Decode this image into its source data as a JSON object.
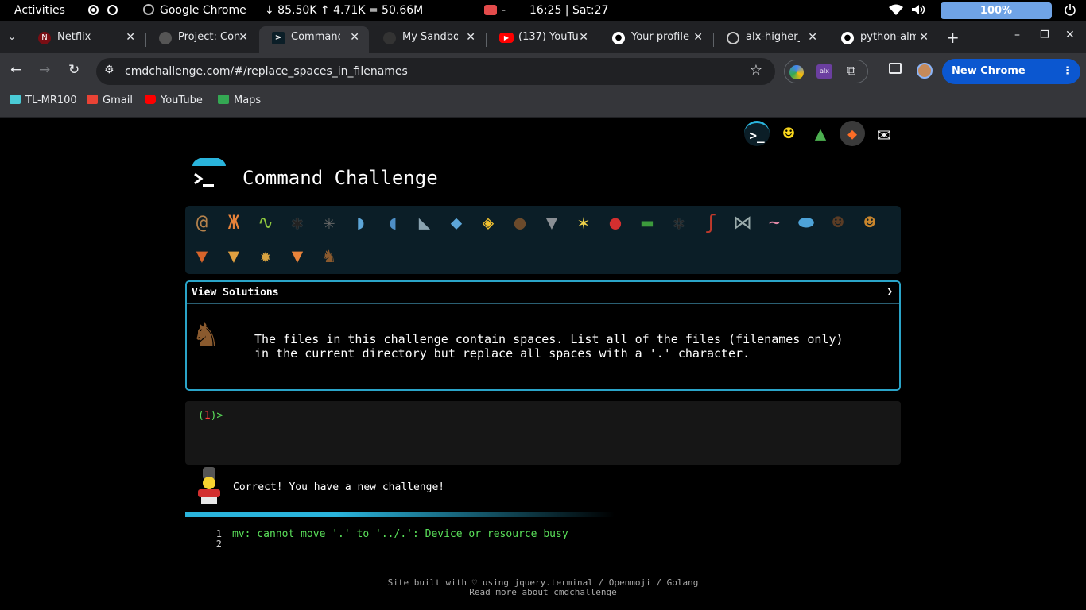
{
  "topbar": {
    "activities": "Activities",
    "app_name": "Google Chrome",
    "net_stats": "↓ 85.50K ↑ 4.71K = 50.66M",
    "indicator_dash": "-",
    "clock": "16:25 | Sat:27",
    "battery": "100%"
  },
  "tabs": [
    {
      "title": "Netflix",
      "favicon": "netflix-icon",
      "color": "#e50914"
    },
    {
      "title": "Project: Con",
      "favicon": "alx-icon",
      "color": "#555555"
    },
    {
      "title": "Command C",
      "favicon": "terminal-icon",
      "color": "#1f8ac0"
    },
    {
      "title": "My Sandbox",
      "favicon": "sandbox-icon",
      "color": "#444444"
    },
    {
      "title": "(137) YouTu",
      "favicon": "youtube-icon",
      "color": "#ff0000"
    },
    {
      "title": "Your profile",
      "favicon": "github-icon",
      "color": "#ffffff"
    },
    {
      "title": "alx-higher_l",
      "favicon": "github-icon",
      "color": "#ffffff"
    },
    {
      "title": "python-alm",
      "favicon": "github-icon",
      "color": "#ffffff"
    }
  ],
  "toolbar": {
    "url": "cmdchallenge.com/#/replace_spaces_in_filenames",
    "update_label": "New Chrome available"
  },
  "bookmarks": [
    {
      "label": "TL-MR100",
      "icon": "tplink-icon",
      "color": "#4acbd6"
    },
    {
      "label": "Gmail",
      "icon": "gmail-icon",
      "color": "#ea4335"
    },
    {
      "label": "YouTube",
      "icon": "youtube-icon",
      "color": "#ff0000"
    },
    {
      "label": "Maps",
      "icon": "maps-icon",
      "color": "#34a853"
    }
  ],
  "site": {
    "title": "Command Challenge",
    "header_icons": [
      "terminal-icon",
      "shushing-face-icon",
      "tree-icon",
      "gitlab-icon",
      "envelope-icon"
    ],
    "badges": [
      "snail",
      "butterfly",
      "caterpillar",
      "ant",
      "spider-web",
      "whale",
      "dolphin",
      "shark",
      "fish",
      "tropical-fish",
      "hedgehog",
      "wolf",
      "bee",
      "ladybug",
      "leaf-bug",
      "spider",
      "scorpion",
      "fly",
      "worm",
      "microbe",
      "monkey",
      "dog",
      "fox",
      "cat",
      "lion",
      "tiger",
      "horse"
    ],
    "view_solutions": "View Solutions",
    "chevron": "❯",
    "challenge_description": "The files in this challenge contain spaces. List all of the files (filenames only)\nin the current directory but replace all spaces with a '.' character.",
    "prompt_open": "(",
    "prompt_number": "1",
    "prompt_close": ")>",
    "result_message": "Correct! You have a new challenge!",
    "output_line_numbers": [
      "1",
      "2"
    ],
    "output_text": "mv: cannot move '.' to '../.': Device or resource busy",
    "footer_line1": "Site built with ♡ using jquery.terminal / Openmoji / Golang",
    "footer_line2": "Read more about cmdchallenge"
  }
}
